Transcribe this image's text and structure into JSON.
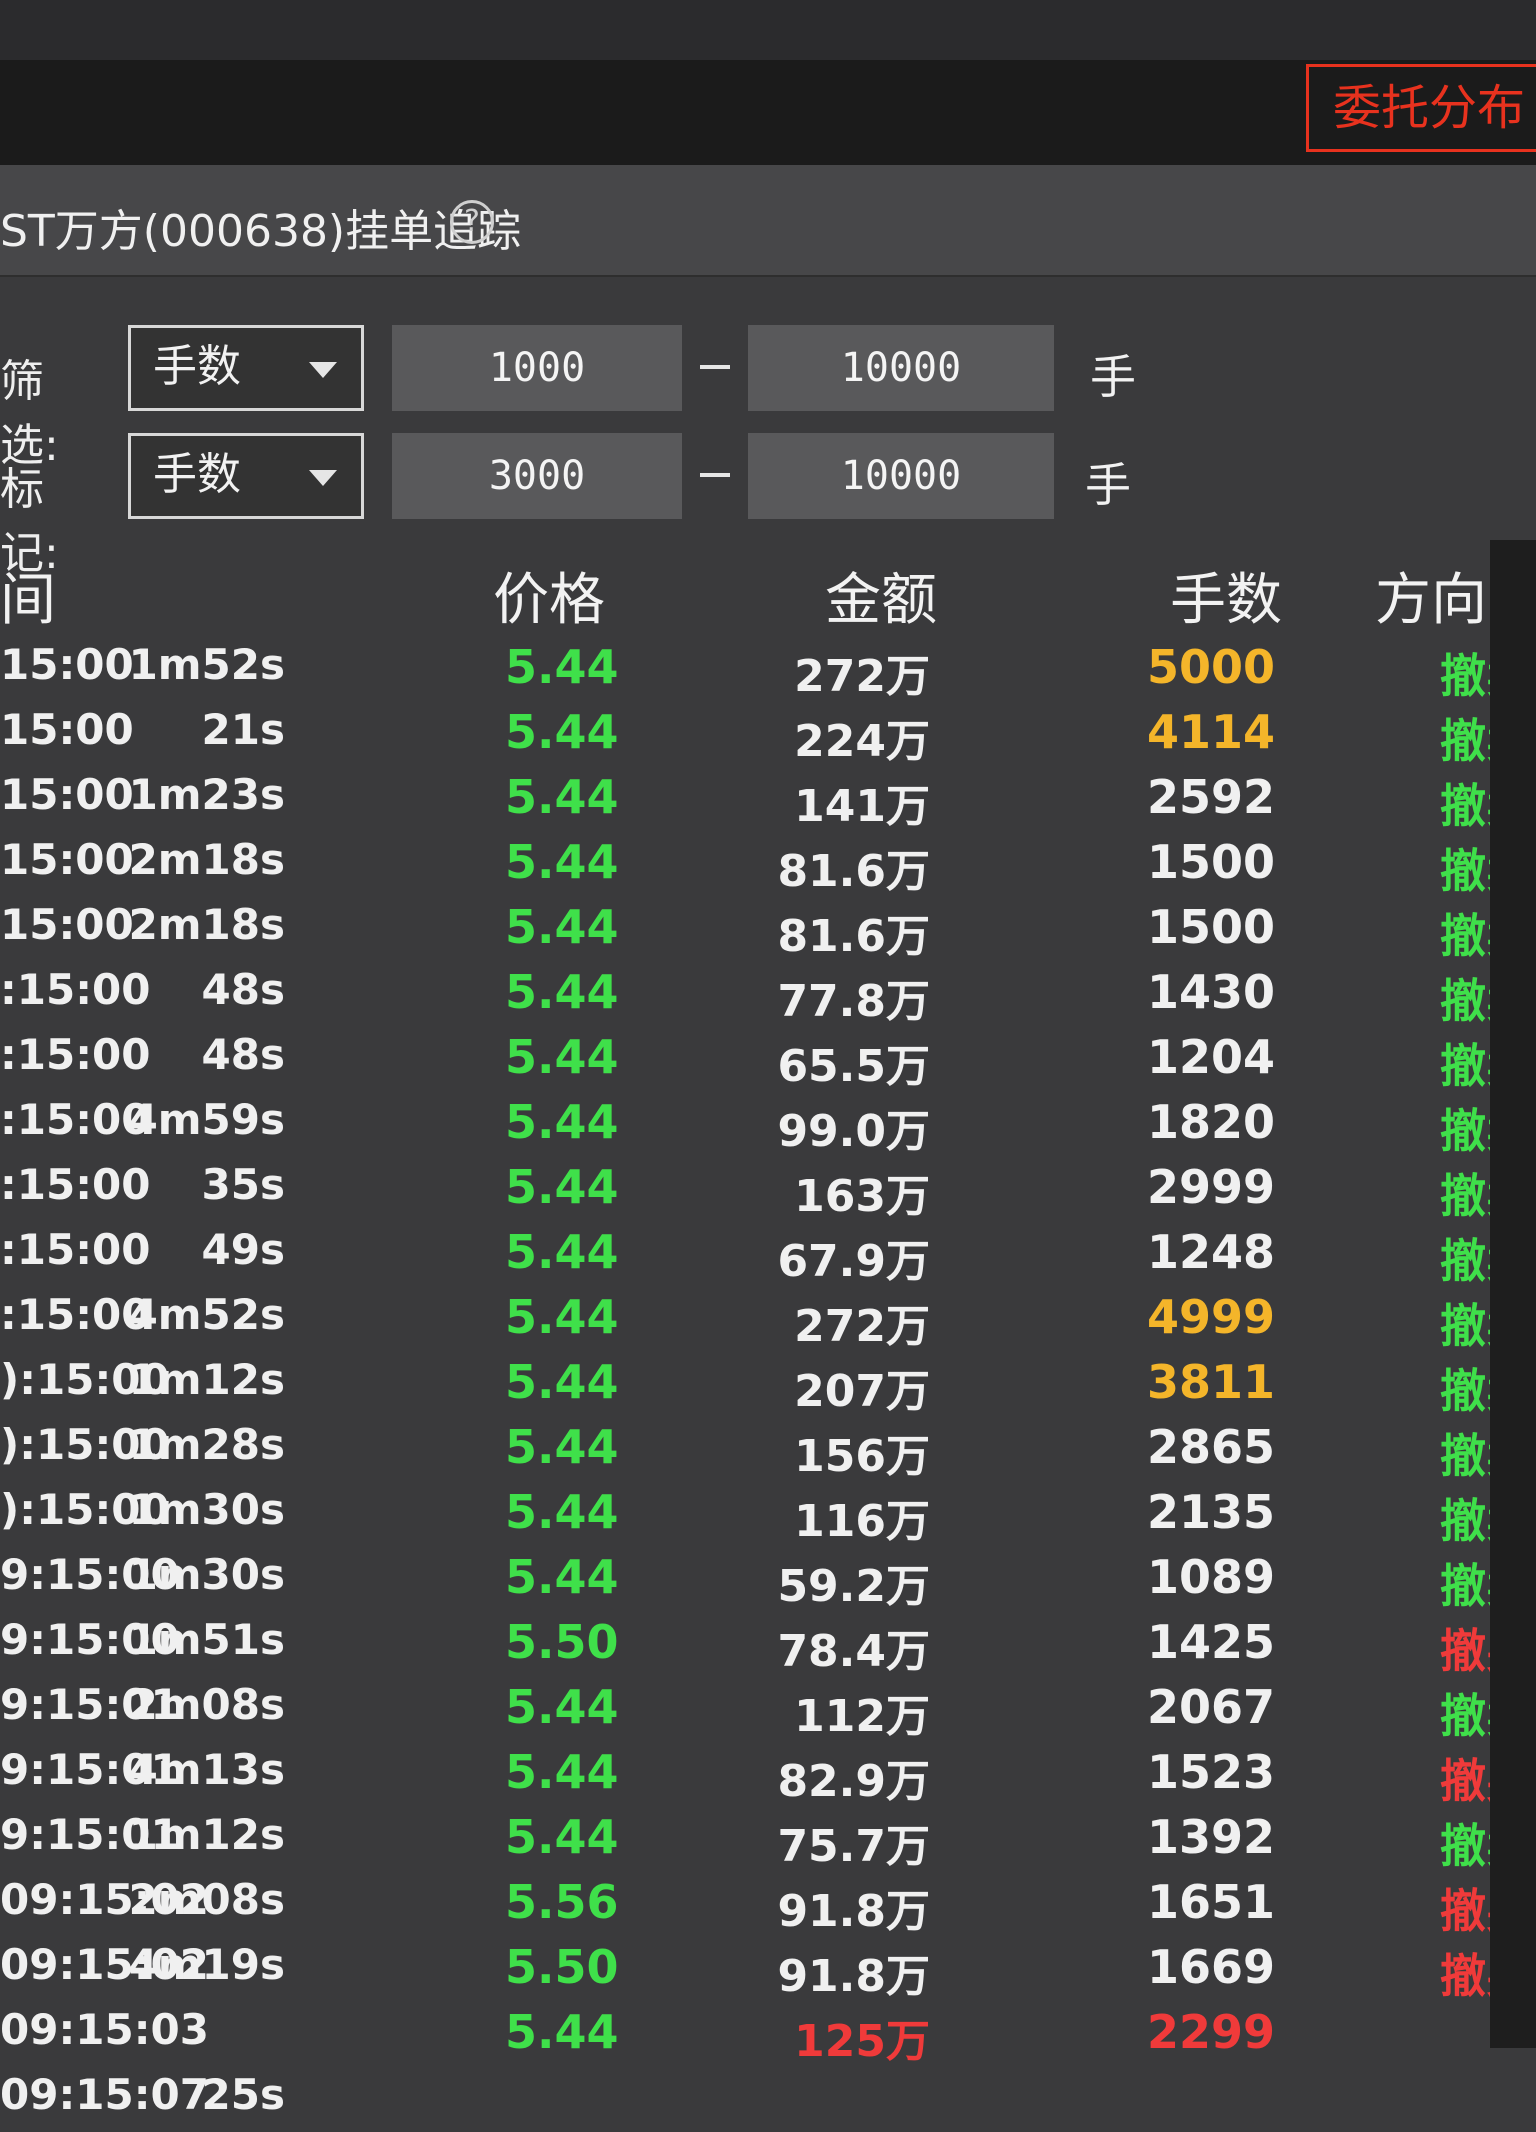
{
  "header": {
    "tab_label": "委托分布"
  },
  "panel": {
    "title": "ST万方(000638)挂单追踪",
    "help_icon": "?"
  },
  "filter": {
    "label": "筛选:",
    "dropdown": "手数",
    "min": "1000",
    "max": "10000",
    "unit": "手"
  },
  "mark": {
    "label": "标记:",
    "dropdown": "手数",
    "min": "3000",
    "max": "10000",
    "unit": "手"
  },
  "columns": {
    "time": "间",
    "price": "价格",
    "amount": "金额",
    "lots": "手数",
    "direction": "方向"
  },
  "colors": {
    "green": "#3fe04a",
    "yellow": "#f4b52a",
    "red": "#f03a3a"
  },
  "rows": [
    {
      "time": "15:00",
      "dur": "1m52s",
      "price": "5.44",
      "amount": "272万",
      "lots": "5000",
      "dir": "撤卖",
      "lots_color": "yellow",
      "price_color": "green",
      "dir_color": "green",
      "amt_color": ""
    },
    {
      "time": "15:00",
      "dur": "21s",
      "price": "5.44",
      "amount": "224万",
      "lots": "4114",
      "dir": "撤卖",
      "lots_color": "yellow",
      "price_color": "green",
      "dir_color": "green",
      "amt_color": ""
    },
    {
      "time": "15:00",
      "dur": "1m23s",
      "price": "5.44",
      "amount": "141万",
      "lots": "2592",
      "dir": "撤卖",
      "lots_color": "",
      "price_color": "green",
      "dir_color": "green",
      "amt_color": ""
    },
    {
      "time": "15:00",
      "dur": "2m18s",
      "price": "5.44",
      "amount": "81.6万",
      "lots": "1500",
      "dir": "撤卖",
      "lots_color": "",
      "price_color": "green",
      "dir_color": "green",
      "amt_color": ""
    },
    {
      "time": "15:00",
      "dur": "2m18s",
      "price": "5.44",
      "amount": "81.6万",
      "lots": "1500",
      "dir": "撤卖",
      "lots_color": "",
      "price_color": "green",
      "dir_color": "green",
      "amt_color": ""
    },
    {
      "time": ":15:00",
      "dur": "48s",
      "price": "5.44",
      "amount": "77.8万",
      "lots": "1430",
      "dir": "撤卖",
      "lots_color": "",
      "price_color": "green",
      "dir_color": "green",
      "amt_color": ""
    },
    {
      "time": ":15:00",
      "dur": "48s",
      "price": "5.44",
      "amount": "65.5万",
      "lots": "1204",
      "dir": "撤卖",
      "lots_color": "",
      "price_color": "green",
      "dir_color": "green",
      "amt_color": ""
    },
    {
      "time": ":15:00",
      "dur": "4m59s",
      "price": "5.44",
      "amount": "99.0万",
      "lots": "1820",
      "dir": "撤卖",
      "lots_color": "",
      "price_color": "green",
      "dir_color": "green",
      "amt_color": ""
    },
    {
      "time": ":15:00",
      "dur": "35s",
      "price": "5.44",
      "amount": "163万",
      "lots": "2999",
      "dir": "撤卖",
      "lots_color": "",
      "price_color": "green",
      "dir_color": "green",
      "amt_color": ""
    },
    {
      "time": ":15:00",
      "dur": "49s",
      "price": "5.44",
      "amount": "67.9万",
      "lots": "1248",
      "dir": "撤卖",
      "lots_color": "",
      "price_color": "green",
      "dir_color": "green",
      "amt_color": ""
    },
    {
      "time": ":15:00",
      "dur": "4m52s",
      "price": "5.44",
      "amount": "272万",
      "lots": "4999",
      "dir": "撤卖",
      "lots_color": "yellow",
      "price_color": "green",
      "dir_color": "green",
      "amt_color": ""
    },
    {
      "time": "):15:00",
      "dur": "1m12s",
      "price": "5.44",
      "amount": "207万",
      "lots": "3811",
      "dir": "撤卖",
      "lots_color": "yellow",
      "price_color": "green",
      "dir_color": "green",
      "amt_color": ""
    },
    {
      "time": "):15:00",
      "dur": "1m28s",
      "price": "5.44",
      "amount": "156万",
      "lots": "2865",
      "dir": "撤卖",
      "lots_color": "",
      "price_color": "green",
      "dir_color": "green",
      "amt_color": ""
    },
    {
      "time": "):15:00",
      "dur": "1m30s",
      "price": "5.44",
      "amount": "116万",
      "lots": "2135",
      "dir": "撤卖",
      "lots_color": "",
      "price_color": "green",
      "dir_color": "green",
      "amt_color": ""
    },
    {
      "time": "9:15:00",
      "dur": "1m30s",
      "price": "5.44",
      "amount": "59.2万",
      "lots": "1089",
      "dir": "撤卖",
      "lots_color": "",
      "price_color": "green",
      "dir_color": "green",
      "amt_color": ""
    },
    {
      "time": "9:15:00",
      "dur": "1m51s",
      "price": "5.50",
      "amount": "78.4万",
      "lots": "1425",
      "dir": "撤买",
      "lots_color": "",
      "price_color": "green",
      "dir_color": "red",
      "amt_color": ""
    },
    {
      "time": "9:15:01",
      "dur": "2m08s",
      "price": "5.44",
      "amount": "112万",
      "lots": "2067",
      "dir": "撤卖",
      "lots_color": "",
      "price_color": "green",
      "dir_color": "green",
      "amt_color": ""
    },
    {
      "time": "9:15:01",
      "dur": "4m13s",
      "price": "5.44",
      "amount": "82.9万",
      "lots": "1523",
      "dir": "撤买",
      "lots_color": "",
      "price_color": "green",
      "dir_color": "red",
      "amt_color": ""
    },
    {
      "time": "9:15:01",
      "dur": "1m12s",
      "price": "5.44",
      "amount": "75.7万",
      "lots": "1392",
      "dir": "撤卖",
      "lots_color": "",
      "price_color": "green",
      "dir_color": "green",
      "amt_color": ""
    },
    {
      "time": "09:15:02",
      "dur": "2m08s",
      "price": "5.56",
      "amount": "91.8万",
      "lots": "1651",
      "dir": "撤买",
      "lots_color": "",
      "price_color": "green",
      "dir_color": "red",
      "amt_color": ""
    },
    {
      "time": "09:15:02",
      "dur": "4m19s",
      "price": "5.50",
      "amount": "91.8万",
      "lots": "1669",
      "dir": "撤买",
      "lots_color": "",
      "price_color": "green",
      "dir_color": "red",
      "amt_color": ""
    },
    {
      "time": "09:15:03",
      "dur": "",
      "price": "5.44",
      "amount": "125万",
      "lots": "2299",
      "dir": "",
      "lots_color": "red",
      "price_color": "green",
      "dir_color": "red",
      "amt_color": "red"
    },
    {
      "time": "09:15:07",
      "dur": "25s",
      "price": "",
      "amount": "",
      "lots": "",
      "dir": "",
      "lots_color": "",
      "price_color": "green",
      "dir_color": "green",
      "amt_color": ""
    }
  ]
}
